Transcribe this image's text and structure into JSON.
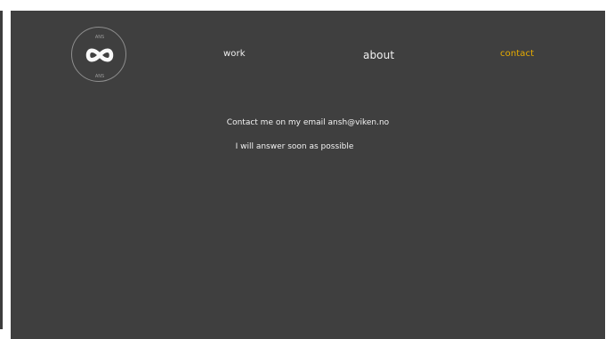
{
  "logo": {
    "icon": "infinity-icon",
    "top_text": "ANS",
    "bottom_text": "ANS"
  },
  "nav": {
    "work": "work",
    "about": "about",
    "contact": "contact",
    "active_color": "#e7ac00"
  },
  "content": {
    "line1": "Contact me on my email ansh@viken.no",
    "line2": "I will answer soon as possible"
  },
  "colors": {
    "background": "#3f3f3f",
    "text": "#f2f2f2"
  }
}
